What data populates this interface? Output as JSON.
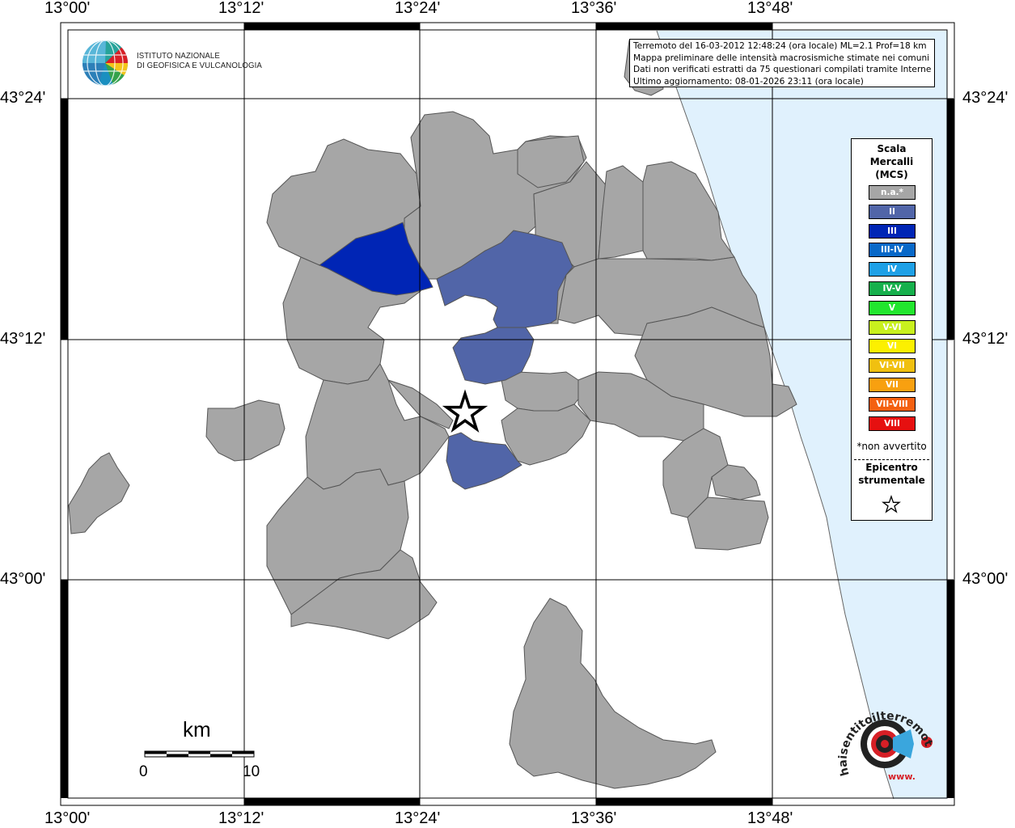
{
  "map": {
    "lon_labels": [
      "13°00'",
      "13°12'",
      "13°24'",
      "13°36'",
      "13°48'"
    ],
    "lat_labels": [
      "43°24'",
      "43°12'",
      "43°00'"
    ],
    "colors": {
      "sea": "#e0f1fd",
      "not_felt": "#a6a6a6",
      "II": "#5165a8",
      "III": "#0025b5",
      "border": "#555555"
    }
  },
  "info": {
    "line1": "Terremoto del 16-03-2012 12:48:24 (ora locale) ML=2.1 Prof=18 km",
    "line2": "Mappa preliminare delle intensità macrosismiche stimate nei comuni",
    "line3": "Dati non verificati estratti da 75 questionari compilati tramite Internet.",
    "line4": "Ultimo aggiornamento: 08-01-2026 23:11 (ora locale)"
  },
  "ingv": {
    "line1": "ISTITUTO NAZIONALE",
    "line2": "DI GEOFISICA E VULCANOLOGIA"
  },
  "legend": {
    "title1": "Scala",
    "title2": "Mercalli",
    "title3": "(MCS)",
    "items": [
      {
        "label": "n.a.*",
        "color": "#a6a6a6"
      },
      {
        "label": "II",
        "color": "#5165a8"
      },
      {
        "label": "III",
        "color": "#0025b5"
      },
      {
        "label": "III-IV",
        "color": "#0868c8"
      },
      {
        "label": "IV",
        "color": "#1ea0e6"
      },
      {
        "label": "IV-V",
        "color": "#16b04c"
      },
      {
        "label": "V",
        "color": "#22e62e"
      },
      {
        "label": "V-VI",
        "color": "#c8f01e"
      },
      {
        "label": "VI",
        "color": "#fcf000"
      },
      {
        "label": "VI-VII",
        "color": "#f0c010"
      },
      {
        "label": "VII",
        "color": "#f8a010"
      },
      {
        "label": "VII-VIII",
        "color": "#f46010"
      },
      {
        "label": "VIII",
        "color": "#e61010"
      }
    ],
    "note": "*non avvertito",
    "epi1": "Epicentro",
    "epi2": "strumentale"
  },
  "scale": {
    "title": "km",
    "start": "0",
    "end": "10"
  },
  "hst": {
    "text": "haisentitoilterremoto.it",
    "www": "www."
  }
}
